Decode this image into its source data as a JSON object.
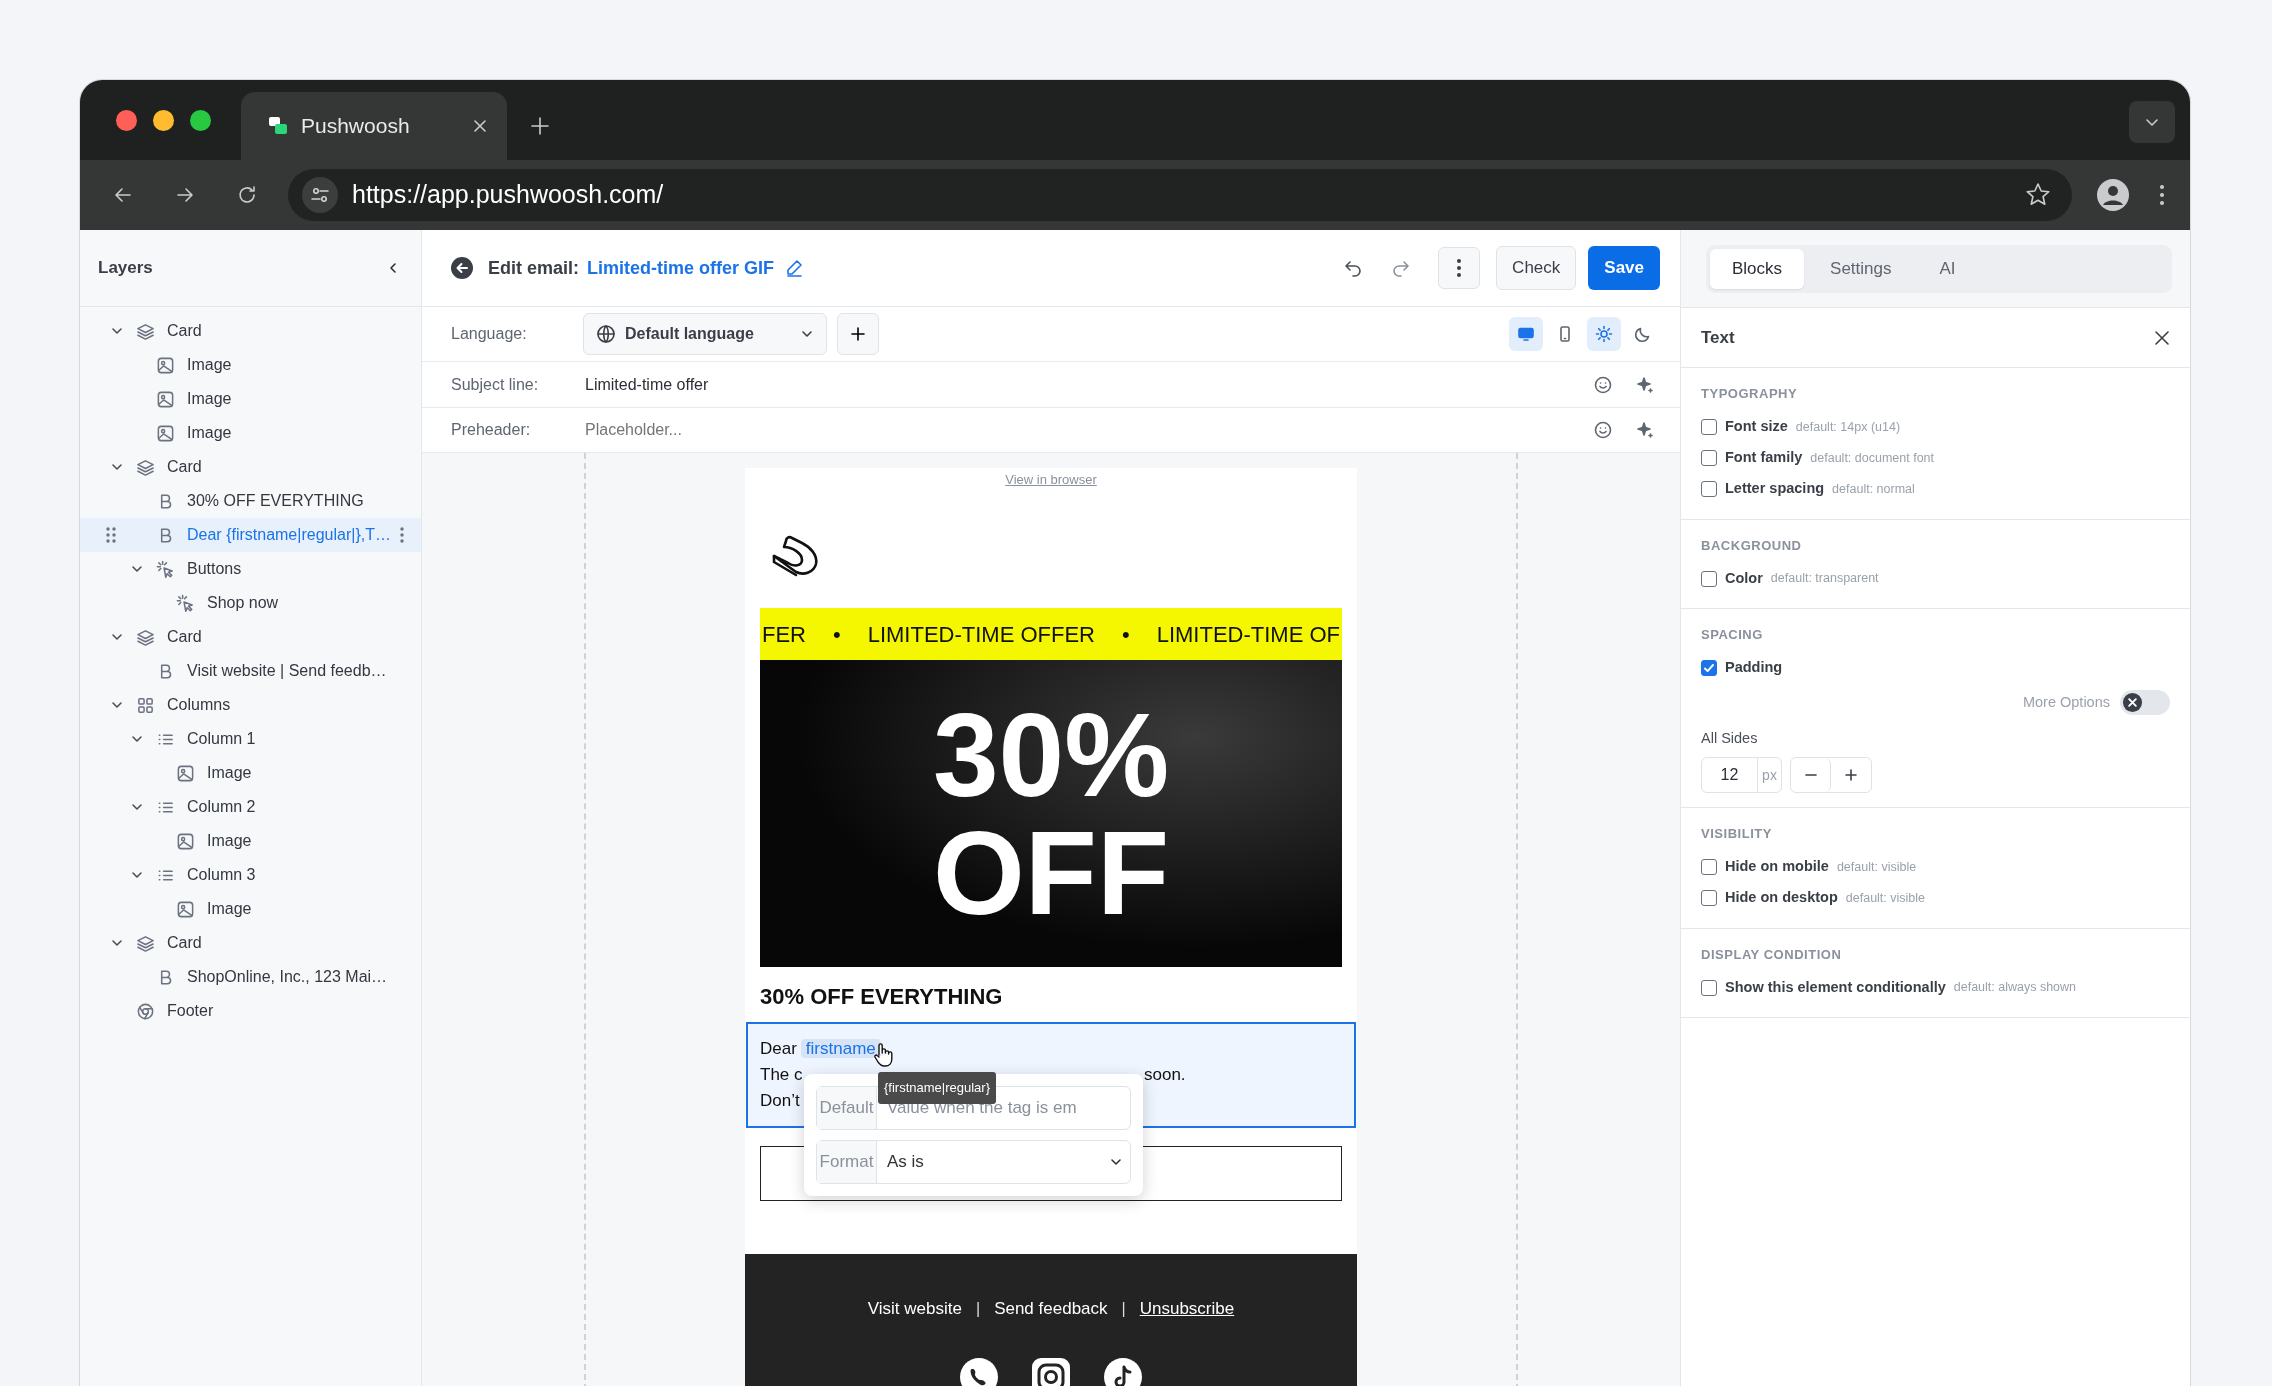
{
  "browser": {
    "tab_title": "Pushwoosh",
    "url": "https://app.pushwoosh.com/"
  },
  "layers": {
    "title": "Layers",
    "items": [
      {
        "label": "Card",
        "kind": "card",
        "expanded": true,
        "selected": false,
        "children": [
          {
            "label": "Image",
            "kind": "image",
            "selected": false
          },
          {
            "label": "Image",
            "kind": "image",
            "selected": false
          },
          {
            "label": "Image",
            "kind": "image",
            "selected": false
          }
        ]
      },
      {
        "label": "Card",
        "kind": "card",
        "expanded": true,
        "selected": false,
        "children": [
          {
            "label": "30% OFF EVERYTHING",
            "kind": "text",
            "selected": false
          },
          {
            "label": "Dear {firstname|regular|},T…",
            "kind": "text",
            "selected": true
          },
          {
            "label": "Buttons",
            "kind": "buttons",
            "expanded": true,
            "selected": false,
            "children": [
              {
                "label": "Shop now",
                "kind": "buttons",
                "selected": false
              }
            ]
          }
        ]
      },
      {
        "label": "Card",
        "kind": "card",
        "expanded": true,
        "selected": false,
        "children": [
          {
            "label": "Visit website | Send feedb…",
            "kind": "text",
            "selected": false
          }
        ]
      },
      {
        "label": "Columns",
        "kind": "columns",
        "expanded": true,
        "selected": false,
        "children": [
          {
            "label": "Column 1",
            "kind": "column",
            "expanded": true,
            "selected": false,
            "children": [
              {
                "label": "Image",
                "kind": "image",
                "selected": false
              }
            ]
          },
          {
            "label": "Column 2",
            "kind": "column",
            "expanded": true,
            "selected": false,
            "children": [
              {
                "label": "Image",
                "kind": "image",
                "selected": false
              }
            ]
          },
          {
            "label": "Column 3",
            "kind": "column",
            "expanded": true,
            "selected": false,
            "children": [
              {
                "label": "Image",
                "kind": "image",
                "selected": false
              }
            ]
          }
        ]
      },
      {
        "label": "Card",
        "kind": "card",
        "expanded": true,
        "selected": false,
        "children": [
          {
            "label": "ShopOnline, Inc., 123 Mai…",
            "kind": "text",
            "selected": false
          }
        ]
      },
      {
        "label": "Footer",
        "kind": "footer",
        "selected": false
      }
    ]
  },
  "editor": {
    "heading": "Edit email:",
    "title": "Limited-time offer GIF",
    "buttons": [
      {
        "label": "Check",
        "kind": "secondary"
      },
      {
        "label": "Save",
        "kind": "primary"
      }
    ],
    "language": {
      "label": "Language:",
      "value": "Default language"
    },
    "view_modes": [
      {
        "kind": "desktop",
        "selected": true
      },
      {
        "kind": "mobile",
        "selected": false
      }
    ],
    "themes": [
      {
        "kind": "light",
        "selected": true
      },
      {
        "kind": "dark",
        "selected": false
      }
    ],
    "fields": [
      {
        "label": "Subject line:",
        "value": "Limited-time offer"
      },
      {
        "label": "Preheader:",
        "placeholder": "Placeholder..."
      }
    ]
  },
  "email": {
    "view_in_browser": "View in browser",
    "banner": [
      "FER",
      "•",
      "LIMITED-TIME OFFER",
      "•",
      "LIMITED-TIME OF"
    ],
    "hero": [
      "30%",
      "OFF"
    ],
    "heading": "30% OFF EVERYTHING",
    "text_block": {
      "selected": true,
      "greeting": "Dear",
      "tag": "firstname",
      "line2_start": "The c",
      "line2_end": "soon.",
      "line3": "Don’t"
    },
    "tag_tooltip": "{firstname|regular}",
    "tag_popover": [
      {
        "label": "Default",
        "kind": "input",
        "placeholder": "Value when the tag is em"
      },
      {
        "label": "Format",
        "kind": "select",
        "value": "As is"
      }
    ],
    "footer_items": [
      {
        "kind": "link",
        "label": "Visit website",
        "underlined": false
      },
      {
        "kind": "separator",
        "label": "|"
      },
      {
        "kind": "link",
        "label": "Send feedback",
        "underlined": false
      },
      {
        "kind": "separator",
        "label": "|"
      },
      {
        "kind": "link",
        "label": "Unsubscribe",
        "underlined": true
      }
    ]
  },
  "properties": {
    "tabs": [
      {
        "label": "Blocks",
        "selected": true
      },
      {
        "label": "Settings",
        "selected": false
      },
      {
        "label": "AI",
        "selected": false
      }
    ],
    "title": "Text",
    "sections": [
      {
        "title": "TYPOGRAPHY",
        "items": [
          {
            "kind": "checkbox",
            "label": "Font size",
            "hint": "default: 14px (u14)",
            "checked": false
          },
          {
            "kind": "checkbox",
            "label": "Font family",
            "hint": "default: document font",
            "checked": false
          },
          {
            "kind": "checkbox",
            "label": "Letter spacing",
            "hint": "default: normal",
            "checked": false
          }
        ]
      },
      {
        "title": "BACKGROUND",
        "items": [
          {
            "kind": "checkbox",
            "label": "Color",
            "hint": "default: transparent",
            "checked": false
          }
        ]
      },
      {
        "title": "SPACING",
        "items": [
          {
            "kind": "checkbox",
            "label": "Padding",
            "checked": true
          },
          {
            "kind": "toggle",
            "label": "More Options",
            "on": false
          },
          {
            "kind": "stepper",
            "label": "All Sides",
            "value": "12",
            "unit": "px"
          }
        ]
      },
      {
        "title": "VISIBILITY",
        "items": [
          {
            "kind": "checkbox",
            "label": "Hide on mobile",
            "hint": "default: visible",
            "checked": false
          },
          {
            "kind": "checkbox",
            "label": "Hide on desktop",
            "hint": "default: visible",
            "checked": false
          }
        ]
      },
      {
        "title": "DISPLAY CONDITION",
        "items": [
          {
            "kind": "checkbox",
            "label": "Show this element conditionally",
            "hint": "default: always shown",
            "checked": false
          }
        ]
      }
    ]
  }
}
